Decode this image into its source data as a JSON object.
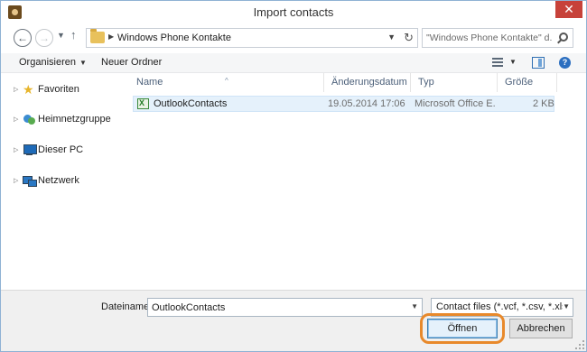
{
  "window": {
    "title": "Import contacts",
    "close_glyph": "✕"
  },
  "nav": {
    "back_glyph": "←",
    "forward_glyph": "→",
    "recent_glyph": "▼",
    "up_glyph": "↑",
    "breadcrumb_sep": "▶",
    "breadcrumb": "Windows Phone Kontakte",
    "address_drop_glyph": "▼",
    "refresh_glyph": "↻",
    "search_placeholder": "\"Windows Phone Kontakte\" d..."
  },
  "toolbar": {
    "organize_label": "Organisieren",
    "organize_drop": "▼",
    "new_folder_label": "Neuer Ordner",
    "view_drop": "▼",
    "help_glyph": "?"
  },
  "navpane": {
    "expander_glyph": "▷",
    "items": [
      {
        "label": "Favoriten",
        "icon": "star-icon"
      },
      {
        "label": "Heimnetzgruppe",
        "icon": "homegroup-icon"
      },
      {
        "label": "Dieser PC",
        "icon": "computer-icon"
      },
      {
        "label": "Netzwerk",
        "icon": "network-icon"
      }
    ]
  },
  "filelist": {
    "columns": [
      "Name",
      "Änderungsdatum",
      "Typ",
      "Größe"
    ],
    "sort_caret": "^",
    "rows": [
      {
        "name": "OutlookContacts",
        "date": "19.05.2014 17:06",
        "type": "Microsoft Office E...",
        "size": "2 KB",
        "icon": "excel-file-icon"
      }
    ]
  },
  "bottom": {
    "filename_label": "Dateiname:",
    "filename_value": "OutlookContacts",
    "filename_drop": "▼",
    "filter_value": "Contact files (*.vcf, *.csv, *.xls, *",
    "filter_drop": "▼",
    "open_label": "Öffnen",
    "cancel_label": "Abbrechen"
  },
  "colors": {
    "highlight_ring": "#e8892b",
    "close_button": "#c7423a",
    "selection": "#e5f1fb"
  }
}
